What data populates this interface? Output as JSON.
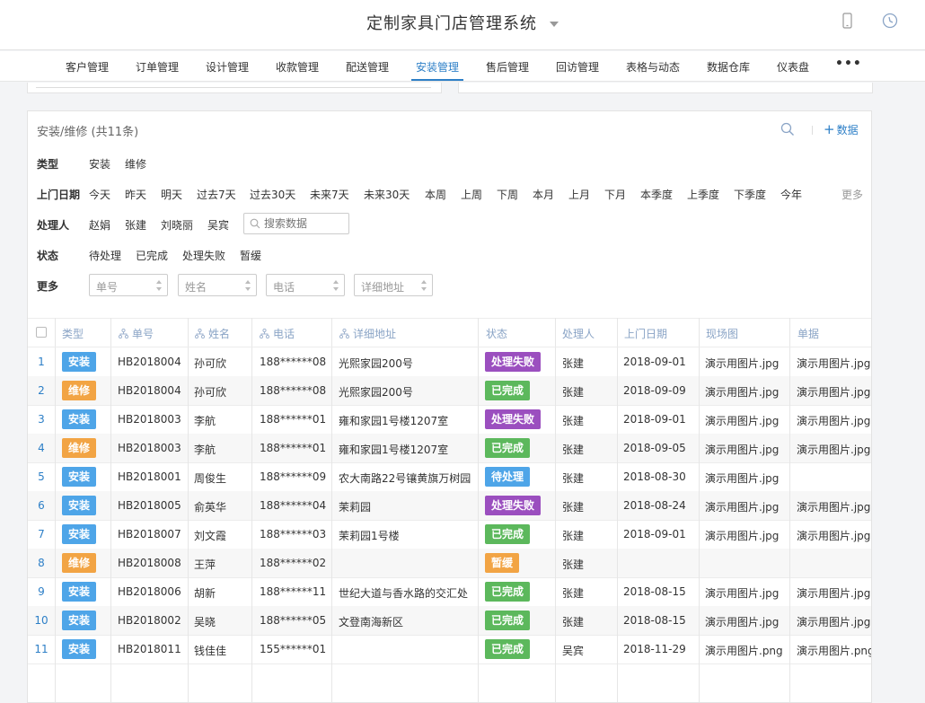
{
  "app": {
    "title": "定制家具门店管理系统"
  },
  "topbar_icons": [
    "mobile-icon",
    "clock-icon"
  ],
  "nav": {
    "items": [
      {
        "label": "客户管理",
        "active": false
      },
      {
        "label": "订单管理",
        "active": false
      },
      {
        "label": "设计管理",
        "active": false
      },
      {
        "label": "收款管理",
        "active": false
      },
      {
        "label": "配送管理",
        "active": false
      },
      {
        "label": "安装管理",
        "active": true
      },
      {
        "label": "售后管理",
        "active": false
      },
      {
        "label": "回访管理",
        "active": false
      },
      {
        "label": "表格与动态",
        "active": false
      },
      {
        "label": "数据仓库",
        "active": false
      },
      {
        "label": "仪表盘",
        "active": false
      }
    ],
    "more": "•••"
  },
  "panel": {
    "title": "安装/维修 (共11条)",
    "add_label": "数据"
  },
  "filters": {
    "type": {
      "label": "类型",
      "options": [
        "安装",
        "维修"
      ]
    },
    "date": {
      "label": "上门日期",
      "options": [
        "今天",
        "昨天",
        "明天",
        "过去7天",
        "过去30天",
        "未来7天",
        "未来30天",
        "本周",
        "上周",
        "下周",
        "本月",
        "上月",
        "下月",
        "本季度",
        "上季度",
        "下季度",
        "今年"
      ],
      "more": "更多"
    },
    "handler": {
      "label": "处理人",
      "options": [
        "赵娟",
        "张建",
        "刘晓丽",
        "吴宾"
      ],
      "search_placeholder": "搜索数据"
    },
    "status": {
      "label": "状态",
      "options": [
        "待处理",
        "已完成",
        "处理失败",
        "暂缓"
      ]
    },
    "more": {
      "label": "更多",
      "fields": [
        "单号",
        "姓名",
        "电话",
        "详细地址"
      ]
    }
  },
  "table": {
    "columns": [
      "类型",
      "单号",
      "姓名",
      "电话",
      "详细地址",
      "状态",
      "处理人",
      "上门日期",
      "现场图",
      "单据"
    ],
    "rows": [
      {
        "idx": "1",
        "type": "安装",
        "no": "HB2018004",
        "name": "孙可欣",
        "phone": "188******08",
        "addr": "光熙家园200号",
        "status": "处理失败",
        "handler": "张建",
        "date": "2018-09-01",
        "photo": "演示用图片.jpg",
        "doc": "演示用图片.jpg"
      },
      {
        "idx": "2",
        "type": "维修",
        "no": "HB2018004",
        "name": "孙可欣",
        "phone": "188******08",
        "addr": "光熙家园200号",
        "status": "已完成",
        "handler": "张建",
        "date": "2018-09-09",
        "photo": "演示用图片.jpg",
        "doc": "演示用图片.jpg"
      },
      {
        "idx": "3",
        "type": "安装",
        "no": "HB2018003",
        "name": "李航",
        "phone": "188******01",
        "addr": "雍和家园1号楼1207室",
        "status": "处理失败",
        "handler": "张建",
        "date": "2018-09-01",
        "photo": "演示用图片.jpg",
        "doc": "演示用图片.jpg"
      },
      {
        "idx": "4",
        "type": "维修",
        "no": "HB2018003",
        "name": "李航",
        "phone": "188******01",
        "addr": "雍和家园1号楼1207室",
        "status": "已完成",
        "handler": "张建",
        "date": "2018-09-05",
        "photo": "演示用图片.jpg",
        "doc": "演示用图片.jpg"
      },
      {
        "idx": "5",
        "type": "安装",
        "no": "HB2018001",
        "name": "周俊生",
        "phone": "188******09",
        "addr": "农大南路22号镶黄旗万树园",
        "status": "待处理",
        "handler": "张建",
        "date": "2018-08-30",
        "photo": "演示用图片.jpg",
        "doc": ""
      },
      {
        "idx": "6",
        "type": "安装",
        "no": "HB2018005",
        "name": "俞英华",
        "phone": "188******04",
        "addr": "茉莉园",
        "status": "处理失败",
        "handler": "张建",
        "date": "2018-08-24",
        "photo": "演示用图片.jpg",
        "doc": "演示用图片.jpg"
      },
      {
        "idx": "7",
        "type": "安装",
        "no": "HB2018007",
        "name": "刘文霞",
        "phone": "188******03",
        "addr": "茉莉园1号楼",
        "status": "已完成",
        "handler": "张建",
        "date": "2018-09-01",
        "photo": "演示用图片.jpg",
        "doc": "演示用图片.jpg"
      },
      {
        "idx": "8",
        "type": "维修",
        "no": "HB2018008",
        "name": "王萍",
        "phone": "188******02",
        "addr": "",
        "status": "暂缓",
        "handler": "张建",
        "date": "",
        "photo": "",
        "doc": ""
      },
      {
        "idx": "9",
        "type": "安装",
        "no": "HB2018006",
        "name": "胡新",
        "phone": "188******11",
        "addr": "世纪大道与香水路的交汇处",
        "status": "已完成",
        "handler": "张建",
        "date": "2018-08-15",
        "photo": "演示用图片.jpg",
        "doc": "演示用图片.jpg"
      },
      {
        "idx": "10",
        "type": "安装",
        "no": "HB2018002",
        "name": "吴晓",
        "phone": "188******05",
        "addr": "文登南海新区",
        "status": "已完成",
        "handler": "张建",
        "date": "2018-08-15",
        "photo": "演示用图片.jpg",
        "doc": "演示用图片.jpg"
      },
      {
        "idx": "11",
        "type": "安装",
        "no": "HB2018011",
        "name": "钱佳佳",
        "phone": "155******01",
        "addr": "",
        "status": "已完成",
        "handler": "吴宾",
        "date": "2018-11-29",
        "photo": "演示用图片.png",
        "doc": "演示用图片.png"
      }
    ]
  },
  "colors": {
    "accent": "#2d7fc7",
    "type": {
      "安装": "#4ea5e8",
      "维修": "#f2a444"
    },
    "status": {
      "处理失败": "#9b4fbf",
      "已完成": "#5cb85c",
      "待处理": "#4ea5e8",
      "暂缓": "#f2a444"
    }
  }
}
